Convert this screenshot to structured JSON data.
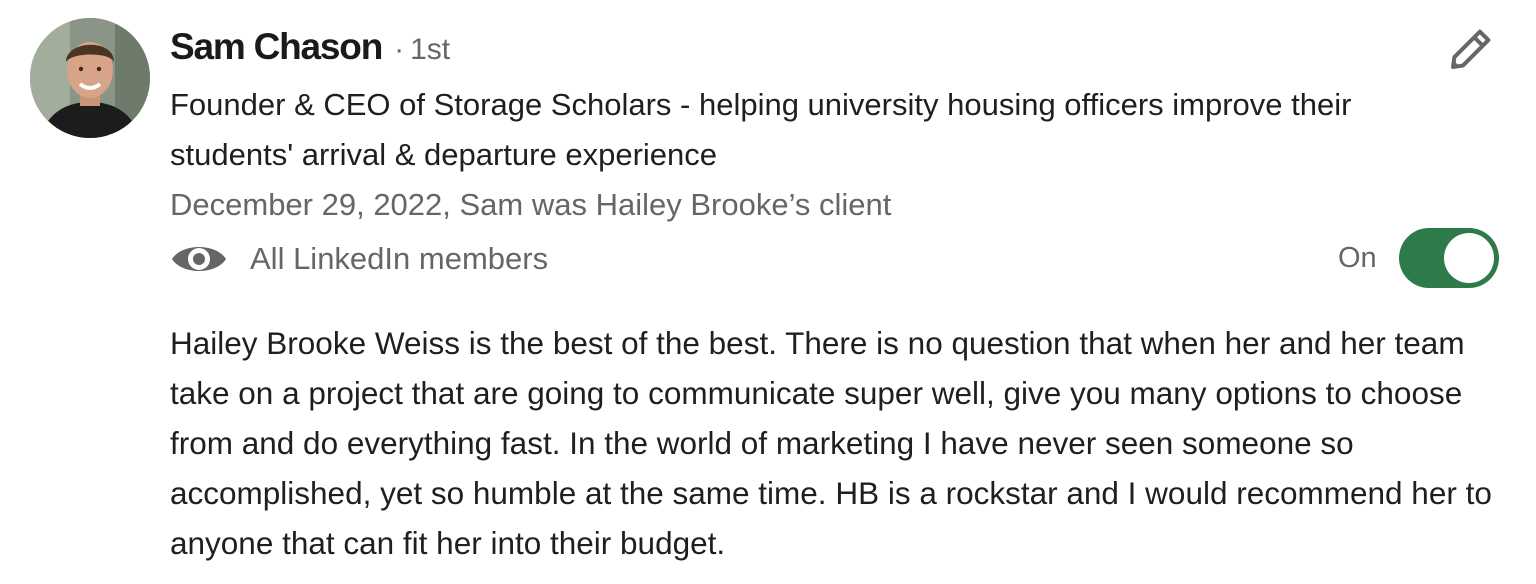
{
  "recommendation": {
    "author": {
      "name": "Sam Chason",
      "degree_separator": "·",
      "degree": "1st",
      "headline": "Founder & CEO of Storage Scholars - helping university housing officers improve their students' arrival & departure experience",
      "avatar_icon": "profile-photo"
    },
    "meta_line": "December 29, 2022, Sam was Hailey Brooke’s client",
    "visibility": {
      "icon": "eye-icon",
      "label": "All LinkedIn members"
    },
    "toggle": {
      "label": "On",
      "state": true,
      "color": "#2f7a4a"
    },
    "edit_icon": "pencil-icon",
    "text": "Hailey Brooke Weiss is the best of the best. There is no question that when her and her team take on a project that are going to communicate super well, give you many options to choose from and do everything fast. In the world of marketing I have never seen someone so accomplished, yet so humble at the same time. HB is a rockstar and I would recommend her to anyone that can fit her into their budget."
  }
}
